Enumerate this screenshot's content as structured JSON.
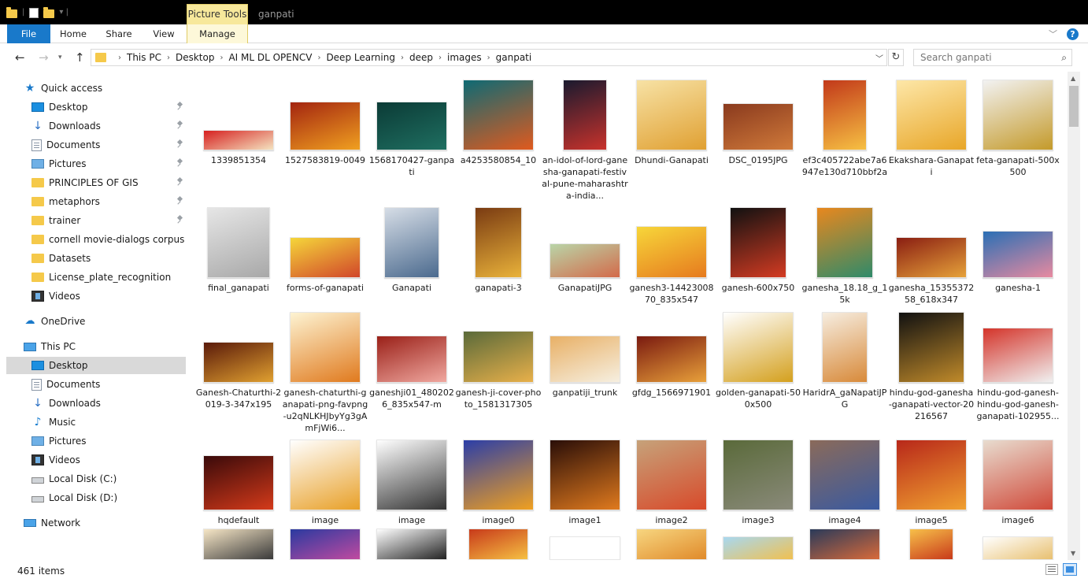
{
  "window": {
    "title": "ganpati",
    "contextual_tab": "Picture Tools"
  },
  "ribbon": {
    "tabs": [
      "File",
      "Home",
      "Share",
      "View",
      "Manage"
    ]
  },
  "address": {
    "crumbs": [
      "This PC",
      "Desktop",
      "AI ML DL OPENCV",
      "Deep Learning",
      "deep",
      "images",
      "ganpati"
    ],
    "search_placeholder": "Search ganpati"
  },
  "sidebar": {
    "quick_access": "Quick access",
    "quick_items": [
      {
        "label": "Desktop",
        "icon": "desktop-icon"
      },
      {
        "label": "Downloads",
        "icon": "download-icon"
      },
      {
        "label": "Documents",
        "icon": "documents-icon"
      },
      {
        "label": "Pictures",
        "icon": "pictures-icon"
      },
      {
        "label": "PRINCIPLES OF GIS",
        "icon": "folder-icon"
      },
      {
        "label": "metaphors",
        "icon": "folder-icon"
      },
      {
        "label": "trainer",
        "icon": "folder-icon"
      },
      {
        "label": "cornell movie-dialogs corpus",
        "icon": "folder-icon"
      },
      {
        "label": "Datasets",
        "icon": "folder-icon"
      },
      {
        "label": "License_plate_recognition",
        "icon": "folder-icon"
      },
      {
        "label": "Videos",
        "icon": "videos-icon"
      }
    ],
    "onedrive": "OneDrive",
    "this_pc": "This PC",
    "pc_items": [
      {
        "label": "Desktop",
        "icon": "desktop-icon"
      },
      {
        "label": "Documents",
        "icon": "documents-icon"
      },
      {
        "label": "Downloads",
        "icon": "download-icon"
      },
      {
        "label": "Music",
        "icon": "music-icon"
      },
      {
        "label": "Pictures",
        "icon": "pictures-icon"
      },
      {
        "label": "Videos",
        "icon": "videos-icon"
      },
      {
        "label": "Local Disk (C:)",
        "icon": "disk-icon"
      },
      {
        "label": "Local Disk (D:)",
        "icon": "disk-icon"
      }
    ],
    "network": "Network"
  },
  "files": {
    "rows": [
      [
        {
          "name": "1339851354",
          "colors": [
            "#d62020",
            "#f4e3c0"
          ]
        },
        {
          "name": "1527583819-0049",
          "colors": [
            "#a32510",
            "#f0a020"
          ]
        },
        {
          "name": "1568170427-ganpati",
          "colors": [
            "#0b3b36",
            "#1f6f61"
          ]
        },
        {
          "name": "a4253580854_10",
          "colors": [
            "#0e6a74",
            "#e05a1e"
          ]
        },
        {
          "name": "an-idol-of-lord-ganesha-ganapati-festival-pune-maharashtra-india...",
          "colors": [
            "#1a1a2e",
            "#c8322c"
          ]
        },
        {
          "name": "Dhundi-Ganapati",
          "colors": [
            "#f7e2a5",
            "#e0a032"
          ]
        },
        {
          "name": "DSC_0195JPG",
          "colors": [
            "#8a3a1e",
            "#d07a3a"
          ]
        },
        {
          "name": "ef3c405722abe7a6947e130d710bbf2a",
          "colors": [
            "#c2391a",
            "#f6c043"
          ]
        },
        {
          "name": "Ekakshara-Ganapati",
          "colors": [
            "#fde7a8",
            "#e8a628"
          ]
        },
        {
          "name": "feta-ganapati-500x500",
          "colors": [
            "#f2f2f2",
            "#c49a2a"
          ]
        }
      ],
      [
        {
          "name": "final_ganapati",
          "colors": [
            "#e6e6e6",
            "#a8a8a8"
          ]
        },
        {
          "name": "forms-of-ganapati",
          "colors": [
            "#f5d63a",
            "#d1462a"
          ]
        },
        {
          "name": "Ganapati",
          "colors": [
            "#d6dde6",
            "#4b6a8e"
          ]
        },
        {
          "name": "ganapati-3",
          "colors": [
            "#7a3b12",
            "#e9b23a"
          ]
        },
        {
          "name": "GanapatiJPG",
          "colors": [
            "#b9d5a8",
            "#d36a4a"
          ]
        },
        {
          "name": "ganesh3-1442300870_835x547",
          "colors": [
            "#f7d63a",
            "#e67a1e"
          ]
        },
        {
          "name": "ganesh-600x750",
          "colors": [
            "#111111",
            "#d43b22"
          ]
        },
        {
          "name": "ganesha_18.18_g_15k",
          "colors": [
            "#e8881e",
            "#2f8a6a"
          ]
        },
        {
          "name": "ganesha_1535537258_618x347",
          "colors": [
            "#8a1e12",
            "#e6a23a"
          ]
        },
        {
          "name": "ganesha-1",
          "colors": [
            "#2a6fb5",
            "#e88aa0"
          ]
        }
      ],
      [
        {
          "name": "Ganesh-Chaturthi-2019-3-347x195",
          "colors": [
            "#5a1a0a",
            "#e0a030"
          ]
        },
        {
          "name": "ganesh-chaturthi-ganapati-png-favpng-u2qNLKHJbyYg3gAmFjWi6...",
          "colors": [
            "#fdf3d2",
            "#e07a1e"
          ]
        },
        {
          "name": "ganeshji01_4802026_835x547-m",
          "colors": [
            "#9a2018",
            "#f0a8a0"
          ]
        },
        {
          "name": "ganesh-ji-cover-photo_1581317305",
          "colors": [
            "#5a6a3a",
            "#e8b04a"
          ]
        },
        {
          "name": "ganpatiji_trunk",
          "colors": [
            "#e8b066",
            "#f6efe0"
          ]
        },
        {
          "name": "gfdg_1566971901",
          "colors": [
            "#7a1a10",
            "#e8a03a"
          ]
        },
        {
          "name": "golden-ganapati-500x500",
          "colors": [
            "#ffffff",
            "#d4a01e"
          ]
        },
        {
          "name": "HaridrA_gaNapatiJPG",
          "colors": [
            "#f6ede0",
            "#d88a3a"
          ]
        },
        {
          "name": "hindu-god-ganesha-ganapati-vector-20216567",
          "colors": [
            "#111111",
            "#c08a2a"
          ]
        },
        {
          "name": "hindu-god-ganesh-hindu-god-ganesh-ganapati-102955...",
          "colors": [
            "#d4342a",
            "#f0f0f0"
          ]
        }
      ],
      [
        {
          "name": "hqdefault",
          "colors": [
            "#3a0a0a",
            "#d43a1a"
          ]
        },
        {
          "name": "image",
          "colors": [
            "#ffffff",
            "#e8a028"
          ]
        },
        {
          "name": "image",
          "colors": [
            "#ffffff",
            "#333333"
          ]
        },
        {
          "name": "image0",
          "colors": [
            "#2b3ea8",
            "#f0a020"
          ]
        },
        {
          "name": "image1",
          "colors": [
            "#2a0e08",
            "#e07a1e"
          ]
        },
        {
          "name": "image2",
          "colors": [
            "#c6a27a",
            "#d84a2a"
          ]
        },
        {
          "name": "image3",
          "colors": [
            "#5a6a3a",
            "#8a8a7a"
          ]
        },
        {
          "name": "image4",
          "colors": [
            "#8a6a5a",
            "#3a5aa0"
          ]
        },
        {
          "name": "image5",
          "colors": [
            "#b8281a",
            "#f0a030"
          ]
        },
        {
          "name": "image6",
          "colors": [
            "#e8dccf",
            "#d04a3a"
          ]
        }
      ],
      [
        {
          "name": "",
          "colors": [
            "#f6e6c6",
            "#3a3a3a"
          ]
        },
        {
          "name": "",
          "colors": [
            "#2a3aa0",
            "#c04aa0"
          ]
        },
        {
          "name": "",
          "colors": [
            "#ffffff",
            "#222222"
          ]
        },
        {
          "name": "",
          "colors": [
            "#c83a1a",
            "#f5c043"
          ]
        },
        {
          "name": "",
          "colors": [
            "#ffffff",
            "#ffffff"
          ]
        },
        {
          "name": "",
          "colors": [
            "#f7d680",
            "#e08a2a"
          ]
        },
        {
          "name": "",
          "colors": [
            "#a8d8f0",
            "#f0c050"
          ]
        },
        {
          "name": "",
          "colors": [
            "#2a3a5a",
            "#d86a3a"
          ]
        },
        {
          "name": "",
          "colors": [
            "#f7c04a",
            "#c83a1a"
          ]
        },
        {
          "name": "",
          "colors": [
            "#ffffff",
            "#e8c070"
          ]
        }
      ]
    ]
  },
  "status": {
    "item_count": "461 items"
  }
}
